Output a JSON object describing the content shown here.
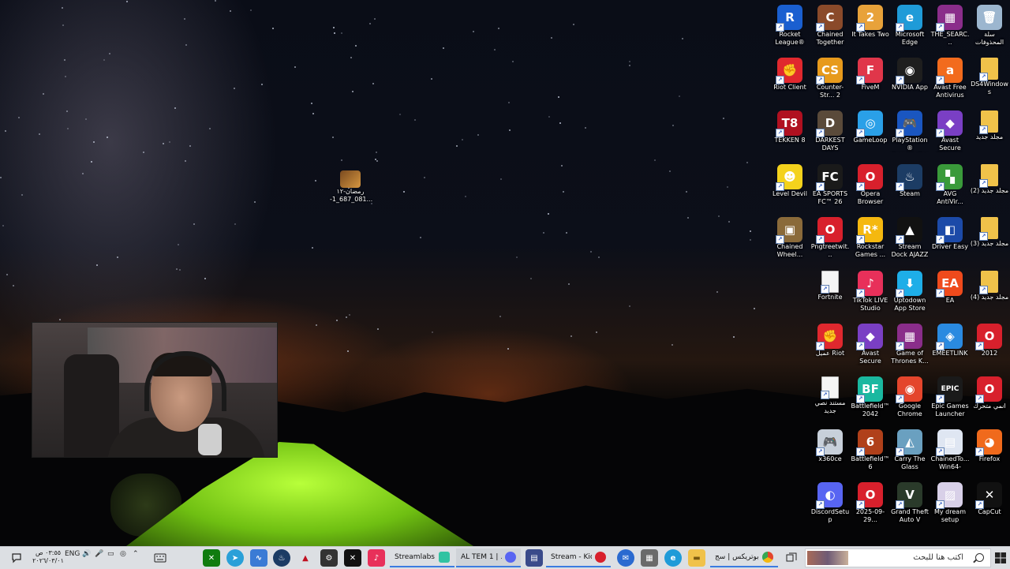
{
  "wallpaper_file": {
    "line1": "رمضان-١٢",
    "line2": "-1_687_081..."
  },
  "desktop_icons": [
    {
      "col": 0,
      "row": 0,
      "label": "Rocket League®",
      "icon": "rocket-league-icon",
      "color": "#1a5fd0",
      "glyph": "R"
    },
    {
      "col": 1,
      "row": 0,
      "label": "Chained Together",
      "icon": "chained-together-icon",
      "color": "#8a4a2a",
      "glyph": "C"
    },
    {
      "col": 2,
      "row": 0,
      "label": "It Takes Two",
      "icon": "it-takes-two-icon",
      "color": "#e8a23a",
      "glyph": "2"
    },
    {
      "col": 3,
      "row": 0,
      "label": "Microsoft Edge",
      "icon": "edge-icon",
      "color": "#1f9bd8",
      "glyph": "e"
    },
    {
      "col": 4,
      "row": 0,
      "label": "THE_SEARC...",
      "icon": "winrar-icon",
      "color": "#8a2d8a",
      "glyph": "▦"
    },
    {
      "col": 5,
      "row": 0,
      "label": "سلة المحذوفات",
      "icon": "recycle-bin-icon",
      "color": "#9cb6cf",
      "glyph": "🗑"
    },
    {
      "col": 0,
      "row": 1,
      "label": "Riot Client",
      "icon": "riot-client-icon",
      "color": "#e0282e",
      "glyph": "✊"
    },
    {
      "col": 1,
      "row": 1,
      "label": "Counter-Str... 2",
      "icon": "counter-strike-icon",
      "color": "#e79a1c",
      "glyph": "CS"
    },
    {
      "col": 2,
      "row": 1,
      "label": "FiveM",
      "icon": "fivem-icon",
      "color": "#e0364a",
      "glyph": "F"
    },
    {
      "col": 3,
      "row": 1,
      "label": "NVIDIA App",
      "icon": "nvidia-icon",
      "color": "#1e1e1e",
      "glyph": "◉"
    },
    {
      "col": 4,
      "row": 1,
      "label": "Avast Free Antivirus",
      "icon": "avast-icon",
      "color": "#f26b1d",
      "glyph": "a"
    },
    {
      "col": 5,
      "row": 1,
      "label": "DS4Windows",
      "icon": "folder-icon",
      "color": "#f0c24a",
      "glyph": ""
    },
    {
      "col": 0,
      "row": 2,
      "label": "TEKKEN 8",
      "icon": "tekken-icon",
      "color": "#b01020",
      "glyph": "T8"
    },
    {
      "col": 1,
      "row": 2,
      "label": "DARKEST DAYS",
      "icon": "darkest-days-icon",
      "color": "#5a4a3a",
      "glyph": "D"
    },
    {
      "col": 2,
      "row": 2,
      "label": "GameLoop",
      "icon": "gameloop-icon",
      "color": "#2aa0e8",
      "glyph": "◎"
    },
    {
      "col": 3,
      "row": 2,
      "label": "PlayStation® Accessories",
      "icon": "playstation-icon",
      "color": "#1a56c0",
      "glyph": "🎮"
    },
    {
      "col": 4,
      "row": 2,
      "label": "Avast Secure Browser",
      "icon": "avast-browser-icon",
      "color": "#7a3fc4",
      "glyph": "◆"
    },
    {
      "col": 5,
      "row": 2,
      "label": "مجلد جديد",
      "icon": "folder-icon",
      "color": "#f0c24a",
      "glyph": ""
    },
    {
      "col": 0,
      "row": 3,
      "label": "Level Devil",
      "icon": "level-devil-icon",
      "color": "#f4d21c",
      "glyph": "☻"
    },
    {
      "col": 1,
      "row": 3,
      "label": "EA SPORTS FC™ 26",
      "icon": "ea-fc-icon",
      "color": "#1a1a1a",
      "glyph": "FC"
    },
    {
      "col": 2,
      "row": 3,
      "label": "Opera Browser",
      "icon": "opera-icon",
      "color": "#d8202c",
      "glyph": "O"
    },
    {
      "col": 3,
      "row": 3,
      "label": "Steam",
      "icon": "steam-icon",
      "color": "#1c3c64",
      "glyph": "♨"
    },
    {
      "col": 4,
      "row": 3,
      "label": "AVG AntiVir...",
      "icon": "avg-icon",
      "color": "#3a9a3a",
      "glyph": "▚"
    },
    {
      "col": 5,
      "row": 3,
      "label": "مجلد جديد (2)",
      "icon": "folder-icon",
      "color": "#f0c24a",
      "glyph": ""
    },
    {
      "col": 0,
      "row": 4,
      "label": "Chained Wheel...",
      "icon": "chained-wheels-icon",
      "color": "#8a6a3a",
      "glyph": "▣"
    },
    {
      "col": 1,
      "row": 4,
      "label": "Pngtreetwit...",
      "icon": "opera-icon",
      "color": "#d8202c",
      "glyph": "O"
    },
    {
      "col": 2,
      "row": 4,
      "label": "Rockstar Games ...",
      "icon": "rockstar-icon",
      "color": "#f5b80f",
      "glyph": "R*"
    },
    {
      "col": 3,
      "row": 4,
      "label": "Stream Dock AJAZZ",
      "icon": "stream-dock-icon",
      "color": "#111111",
      "glyph": "▲"
    },
    {
      "col": 4,
      "row": 4,
      "label": "Driver Easy",
      "icon": "driver-easy-icon",
      "color": "#1c4aa8",
      "glyph": "◧"
    },
    {
      "col": 5,
      "row": 4,
      "label": "مجلد جديد (3)",
      "icon": "folder-icon",
      "color": "#f0c24a",
      "glyph": ""
    },
    {
      "col": 1,
      "row": 5,
      "label": "Fortnite",
      "icon": "file-icon",
      "color": "#f5f5f5",
      "glyph": ""
    },
    {
      "col": 2,
      "row": 5,
      "label": "TikTok LIVE Studio",
      "icon": "tiktok-icon",
      "color": "#e8305a",
      "glyph": "♪"
    },
    {
      "col": 3,
      "row": 5,
      "label": "Uptodown App Store",
      "icon": "uptodown-icon",
      "color": "#1eaee8",
      "glyph": "⬇"
    },
    {
      "col": 4,
      "row": 5,
      "label": "EA",
      "icon": "ea-icon",
      "color": "#ef4a1c",
      "glyph": "EA"
    },
    {
      "col": 5,
      "row": 5,
      "label": "مجلد جديد (4)",
      "icon": "folder-icon",
      "color": "#f0c24a",
      "glyph": ""
    },
    {
      "col": 1,
      "row": 6,
      "label": "عميل Riot",
      "icon": "riot-client-icon",
      "color": "#e0282e",
      "glyph": "✊"
    },
    {
      "col": 2,
      "row": 6,
      "label": "Avast Secure Browser",
      "icon": "avast-browser-icon",
      "color": "#7a3fc4",
      "glyph": "◆"
    },
    {
      "col": 3,
      "row": 6,
      "label": "Game of Thrones K...",
      "icon": "winrar-icon",
      "color": "#8a2d8a",
      "glyph": "▦"
    },
    {
      "col": 4,
      "row": 6,
      "label": "EMEETLINK",
      "icon": "emeetlink-icon",
      "color": "#2a8ae0",
      "glyph": "◈"
    },
    {
      "col": 5,
      "row": 6,
      "label": "2012",
      "icon": "opera-icon",
      "color": "#d8202c",
      "glyph": "O"
    },
    {
      "col": 1,
      "row": 7,
      "label": "مستند نصي جديد",
      "icon": "file-icon",
      "color": "#f5f5f5",
      "glyph": ""
    },
    {
      "col": 2,
      "row": 7,
      "label": "Battlefield™ 2042",
      "icon": "battlefield-icon",
      "color": "#1ab8a0",
      "glyph": "BF"
    },
    {
      "col": 3,
      "row": 7,
      "label": "Google Chrome",
      "icon": "chrome-icon",
      "color": "#e4452c",
      "glyph": "◉"
    },
    {
      "col": 4,
      "row": 7,
      "label": "Epic Games Launcher",
      "icon": "epic-games-icon",
      "color": "#1a1a1a",
      "glyph": "EPIC"
    },
    {
      "col": 5,
      "row": 7,
      "label": "انمي متحرك",
      "icon": "opera-icon",
      "color": "#d8202c",
      "glyph": "O"
    },
    {
      "col": 1,
      "row": 8,
      "label": "x360ce",
      "icon": "gamepad-icon",
      "color": "#c8d0da",
      "glyph": "🎮"
    },
    {
      "col": 2,
      "row": 8,
      "label": "Battlefield™ 6",
      "icon": "battlefield6-icon",
      "color": "#b0401a",
      "glyph": "6"
    },
    {
      "col": 3,
      "row": 8,
      "label": "Carry The Glass",
      "icon": "carry-glass-icon",
      "color": "#6aa0c0",
      "glyph": "◭"
    },
    {
      "col": 4,
      "row": 8,
      "label": "ChainedTo... Win64-Ship...",
      "icon": "exe-icon",
      "color": "#dfe6f2",
      "glyph": "▤"
    },
    {
      "col": 5,
      "row": 8,
      "label": "Firefox",
      "icon": "firefox-icon",
      "color": "#f06a1c",
      "glyph": "◕"
    },
    {
      "col": 1,
      "row": 9,
      "label": "DiscordSetup",
      "icon": "discord-icon",
      "color": "#5865f2",
      "glyph": "◐"
    },
    {
      "col": 2,
      "row": 9,
      "label": "2025-09-29...",
      "icon": "opera-icon",
      "color": "#d8202c",
      "glyph": "O"
    },
    {
      "col": 3,
      "row": 9,
      "label": "Grand Theft Auto V",
      "icon": "gta-icon",
      "color": "#2a3a2a",
      "glyph": "V"
    },
    {
      "col": 4,
      "row": 9,
      "label": "My dream setup",
      "icon": "image-file-icon",
      "color": "#d8d0e8",
      "glyph": "▨"
    },
    {
      "col": 5,
      "row": 9,
      "label": "CapCut",
      "icon": "capcut-icon",
      "color": "#111111",
      "glyph": "✕"
    }
  ],
  "taskbar": {
    "search_placeholder": "اكتب هنا للبحث",
    "windows": [
      {
        "label": "بوتريكس | سج...",
        "icon": "chrome-icon",
        "color": "#e4452c"
      },
      {
        "label": "Stream - Kick...",
        "icon": "opera-icon",
        "color": "#d8202c"
      },
      {
        "label": "AL TEM 1 | ...",
        "icon": "discord-icon",
        "color": "#5865f2"
      },
      {
        "label": "Streamlabs D...",
        "icon": "streamlabs-icon",
        "color": "#31c3a2"
      }
    ],
    "language": "ENG",
    "clock_time": "٠٣:٥٥ ص",
    "clock_date": "٢٠٢٦/٠٣/٠١"
  }
}
